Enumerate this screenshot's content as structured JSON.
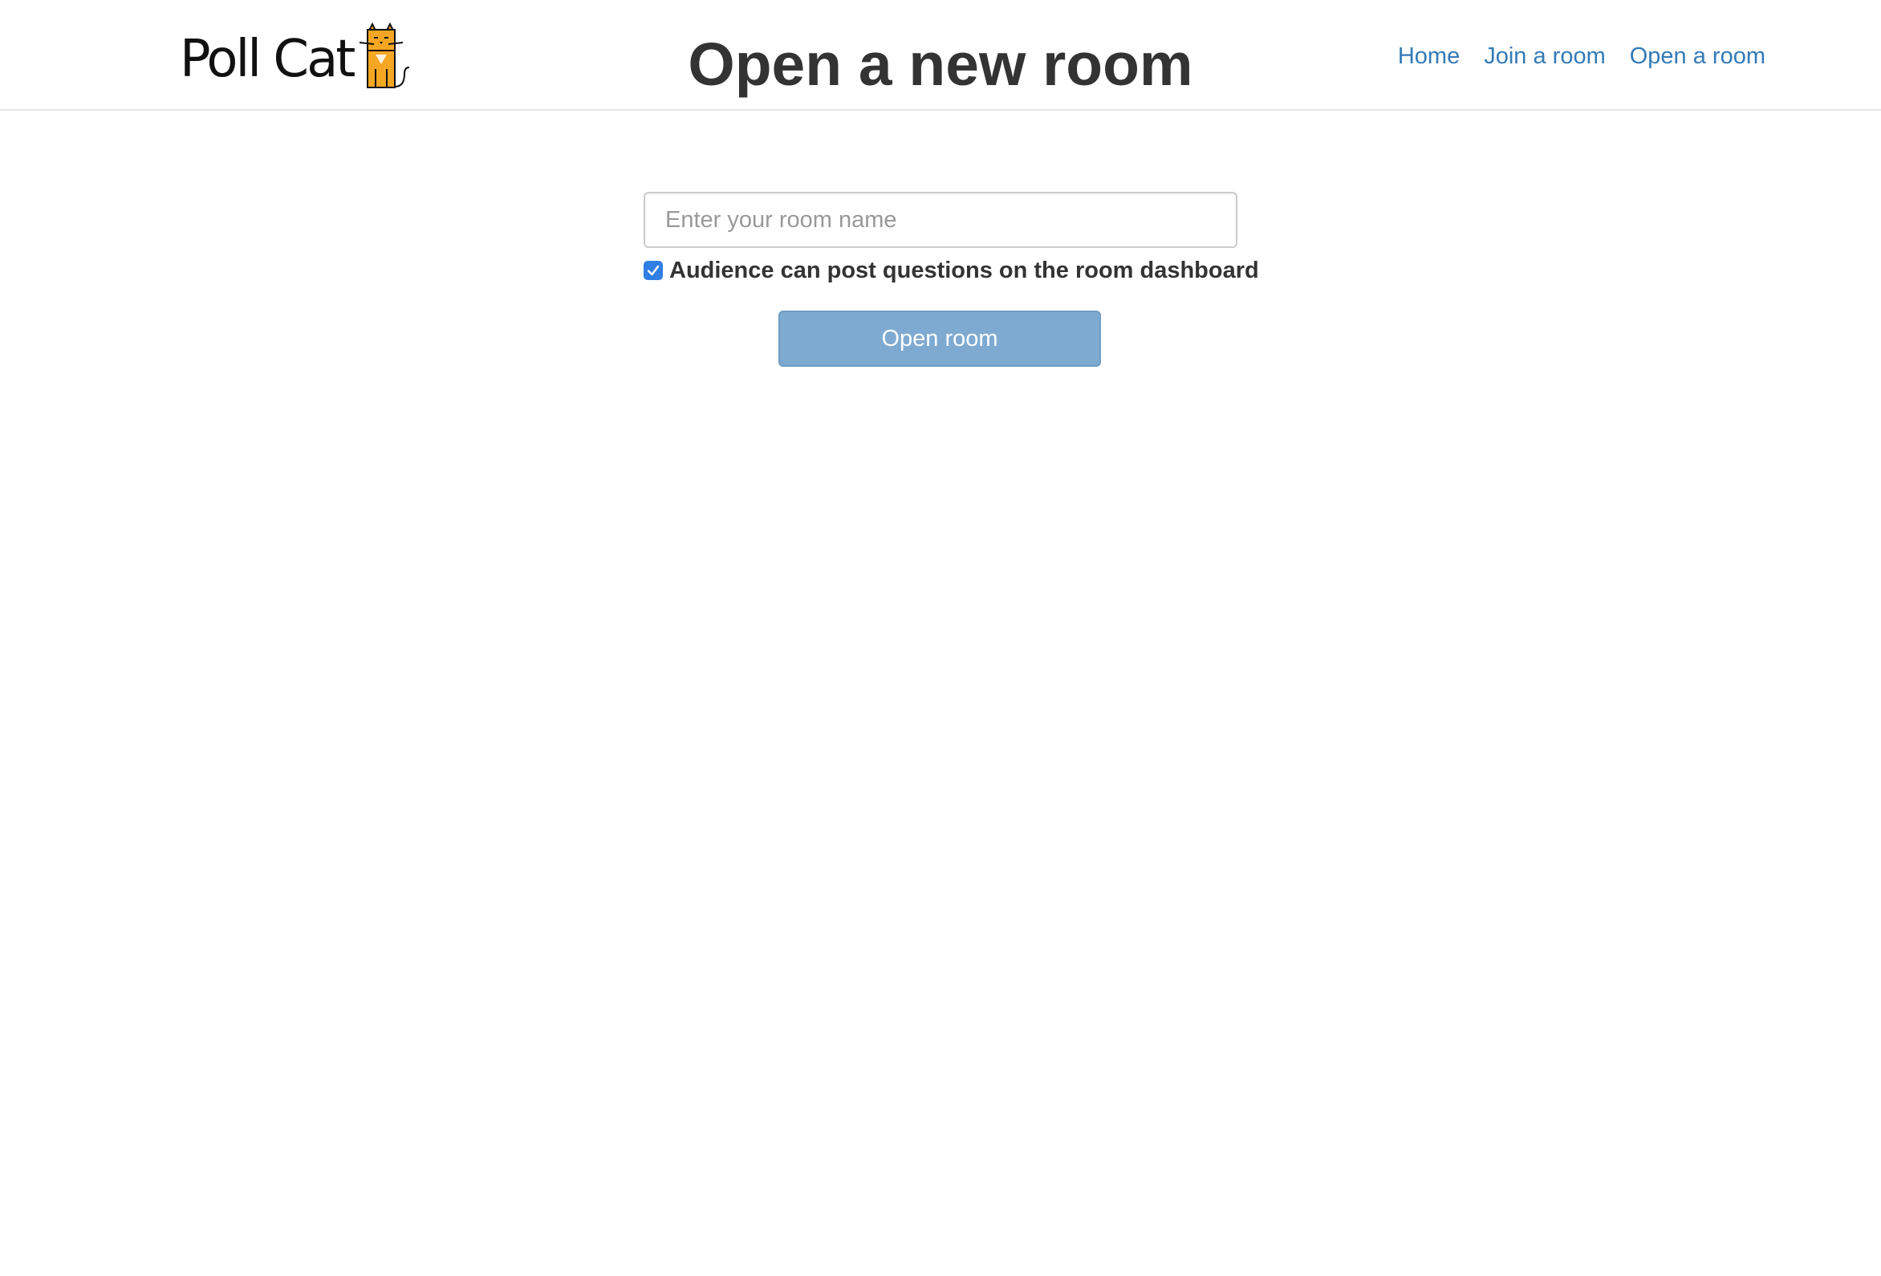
{
  "brand": {
    "name": "Poll Cat",
    "logo_icon": "cat-icon"
  },
  "header": {
    "title": "Open a new room"
  },
  "nav": {
    "items": [
      {
        "label": "Home"
      },
      {
        "label": "Join a room"
      },
      {
        "label": "Open a room"
      }
    ]
  },
  "form": {
    "room_name_placeholder": "Enter your room name",
    "room_name_value": "",
    "audience_questions_label": "Audience can post questions on the room dashboard",
    "audience_questions_checked": true,
    "submit_label": "Open room"
  },
  "colors": {
    "link": "#337ab7",
    "checkbox": "#2f7ee3",
    "button": "#7eaad1",
    "cat": "#f5a623"
  }
}
